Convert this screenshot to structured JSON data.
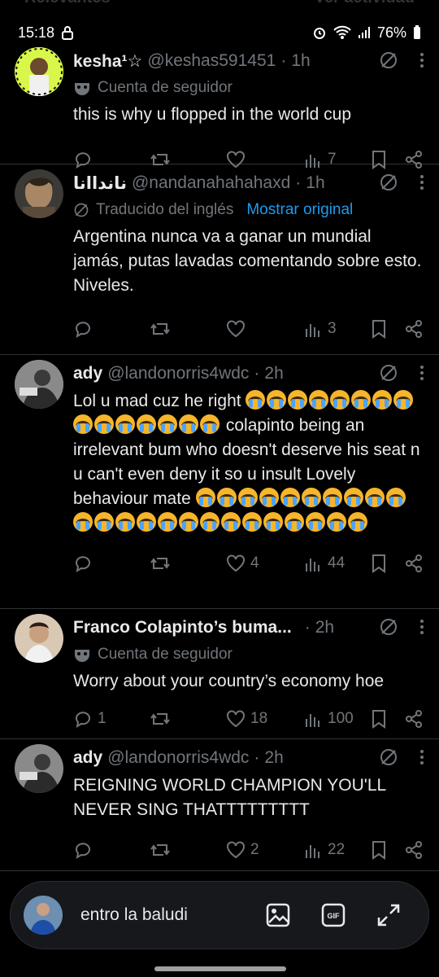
{
  "status": {
    "time": "15:18",
    "battery": "76%"
  },
  "ghost": {
    "left": "Relevantes",
    "right": "Ver actividad"
  },
  "tweets": [
    {
      "name": "kesha¹☆",
      "handle": "@keshas591451",
      "time": "1h",
      "meta": "Cuenta de seguidor",
      "text": "this is why u flopped in the world cup",
      "replies": "",
      "retweets": "",
      "likes": "",
      "views": "7"
    },
    {
      "name": "نانداانا",
      "handle": "@nandanahahahaxd",
      "time": "1h",
      "meta": "Traducido del inglés",
      "meta_link": "Mostrar original",
      "text": "Argentina nunca va a ganar un mundial jamás, putas lavadas comentando sobre esto. Niveles.",
      "replies": "",
      "retweets": "",
      "likes": "",
      "views": "3"
    },
    {
      "name": "ady",
      "handle": "@landonorris4wdc",
      "time": "2h",
      "text_a": "Lol u mad cuz he right",
      "text_b": "colapinto being an irrelevant bum who doesn't deserve his seat n u can't even deny it so u insult Lovely behaviour mate",
      "replies": "",
      "retweets": "",
      "likes": "4",
      "views": "44"
    },
    {
      "name": "Franco Colapinto’s buma...",
      "time": "2h",
      "meta": "Cuenta de seguidor",
      "text": "Worry about your country’s economy hoe",
      "replies": "1",
      "retweets": "",
      "likes": "18",
      "views": "100"
    },
    {
      "name": "ady",
      "handle": "@landonorris4wdc",
      "time": "2h",
      "text": "REIGNING WORLD CHAMPION YOU'LL NEVER SING THATTTTTTTTT",
      "replies": "",
      "retweets": "",
      "likes": "2",
      "views": "22"
    }
  ],
  "composer": {
    "text": "entro la baludi"
  },
  "colors": {
    "accent": "#1d9bf0",
    "muted": "#71767b",
    "text": "#e7e9ea",
    "background": "#000000"
  }
}
